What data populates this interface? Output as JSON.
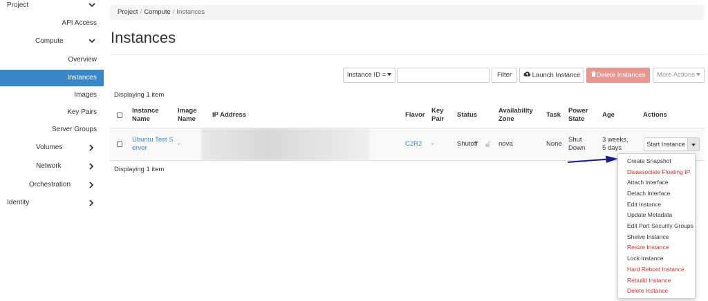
{
  "sidebar": {
    "project": "Project",
    "api_access": "API Access",
    "compute": "Compute",
    "overview": "Overview",
    "instances": "Instances",
    "images": "Images",
    "key_pairs": "Key Pairs",
    "server_groups": "Server Groups",
    "volumes": "Volumes",
    "network": "Network",
    "orchestration": "Orchestration",
    "identity": "Identity"
  },
  "breadcrumb": {
    "project": "Project",
    "compute": "Compute",
    "instances": "Instances",
    "separator": "/"
  },
  "page_title": "Instances",
  "toolbar": {
    "filter_field": "Instance ID =",
    "search_value": "",
    "filter_label": "Filter",
    "launch_label": "Launch Instance",
    "delete_label": "Delete Instances",
    "more_label": "More Actions"
  },
  "displaying": "Displaying 1 item",
  "table": {
    "headers": {
      "name_l1": "Instance",
      "name_l2": "Name",
      "image_l1": "Image",
      "image_l2": "Name",
      "ip": "IP Address",
      "flavor": "Flavor",
      "keypair_l1": "Key",
      "keypair_l2": "Pair",
      "status": "Status",
      "az_l1": "Availability",
      "az_l2": "Zone",
      "task": "Task",
      "power_l1": "Power",
      "power_l2": "State",
      "age": "Age",
      "actions": "Actions"
    },
    "row": {
      "name_l1": "Ubuntu Test S",
      "name_l2": "erver",
      "image": "-",
      "flavor": "C2R2",
      "keypair": "-",
      "status": "Shutoff",
      "az": "nova",
      "task": "None",
      "power_l1": "Shut",
      "power_l2": "Down",
      "age_l1": "3 weeks,",
      "age_l2": "5 days",
      "action": "Start Instance"
    }
  },
  "dropdown": {
    "create_snapshot": "Create Snapshot",
    "disassociate_ip": "Disassociate Floating IP",
    "attach_interface": "Attach Interface",
    "detach_interface": "Detach Interface",
    "edit_instance": "Edit Instance",
    "update_metadata": "Update Metadata",
    "edit_port_security": "Edit Port Security Groups",
    "shelve": "Shelve Instance",
    "resize": "Resize Instance",
    "lock": "Lock Instance",
    "hard_reboot": "Hard Reboot Instance",
    "rebuild": "Rebuild Instance",
    "delete": "Delete Instance"
  },
  "colors": {
    "accent": "#3a87c8",
    "danger": "#c9302c",
    "danger_button": "#e69791",
    "arrow": "#1a1a8c"
  }
}
